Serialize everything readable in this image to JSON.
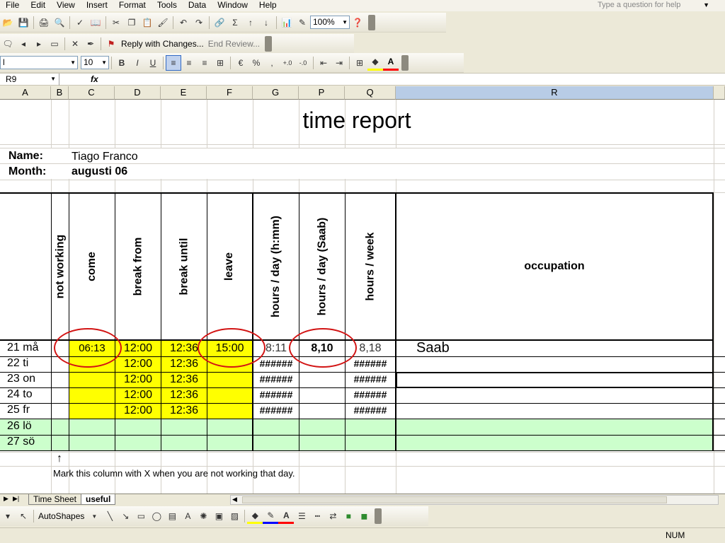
{
  "menu": {
    "items": [
      "File",
      "Edit",
      "View",
      "Insert",
      "Format",
      "Tools",
      "Data",
      "Window",
      "Help"
    ],
    "help_placeholder": "Type a question for help"
  },
  "toolbar": {
    "zoom": "100%",
    "reply_with_changes": "Reply with Changes...",
    "end_review": "End Review...",
    "font_name": "l",
    "font_size": "10",
    "autosum": "Σ",
    "bold": "B",
    "italic": "I",
    "underline": "U",
    "percent": "%",
    "comma": ",",
    "autoshapes": "AutoShapes"
  },
  "formula_bar": {
    "name_box": "R9",
    "fx": "fx"
  },
  "columns": [
    "A",
    "B",
    "C",
    "D",
    "E",
    "F",
    "G",
    "P",
    "Q",
    "R"
  ],
  "sheet": {
    "title": "time report",
    "name_label": "Name:",
    "name_value": "Tiago Franco",
    "month_label": "Month:",
    "month_value": "augusti 06",
    "headers": {
      "not_working": "not working",
      "come": "come",
      "break_from": "break from",
      "break_until": "break until",
      "leave": "leave",
      "hours_day_hmm": "hours / day (h:mm)",
      "hours_day_saab": "hours / day (Saab)",
      "hours_week": "hours / week",
      "occupation": "occupation"
    },
    "rows": [
      {
        "day": "21 må",
        "come": "06:13",
        "break_from": "12:00",
        "break_until": "12:36",
        "leave": "15:00",
        "hours_hmm": "8:11",
        "hours_saab": "8,10",
        "hours_week": "8,18",
        "occupation": "Saab"
      },
      {
        "day": "22 ti",
        "come": "",
        "break_from": "12:00",
        "break_until": "12:36",
        "leave": "",
        "hours_hmm": "######",
        "hours_saab": "",
        "hours_week": "######",
        "occupation": ""
      },
      {
        "day": "23 on",
        "come": "",
        "break_from": "12:00",
        "break_until": "12:36",
        "leave": "",
        "hours_hmm": "######",
        "hours_saab": "",
        "hours_week": "######",
        "occupation": ""
      },
      {
        "day": "24 to",
        "come": "",
        "break_from": "12:00",
        "break_until": "12:36",
        "leave": "",
        "hours_hmm": "######",
        "hours_saab": "",
        "hours_week": "######",
        "occupation": ""
      },
      {
        "day": "25 fr",
        "come": "",
        "break_from": "12:00",
        "break_until": "12:36",
        "leave": "",
        "hours_hmm": "######",
        "hours_saab": "",
        "hours_week": "######",
        "occupation": ""
      },
      {
        "day": "26 lö",
        "come": "",
        "break_from": "",
        "break_until": "",
        "leave": "",
        "hours_hmm": "",
        "hours_saab": "",
        "hours_week": "",
        "occupation": ""
      },
      {
        "day": "27 sö",
        "come": "",
        "break_from": "",
        "break_until": "",
        "leave": "",
        "hours_hmm": "",
        "hours_saab": "",
        "hours_week": "",
        "occupation": ""
      }
    ],
    "note": "Mark this column with X when you are not working that day.",
    "note_arrow": "↑"
  },
  "sheet_tabs": [
    "Time Sheet",
    "useful"
  ],
  "status": {
    "num": "NUM"
  },
  "colors": {
    "highlight_yellow": "#ffff00",
    "weekend_green": "#ccffcc",
    "annotation_red": "#d21414",
    "selected_column": "#b8cce6"
  }
}
